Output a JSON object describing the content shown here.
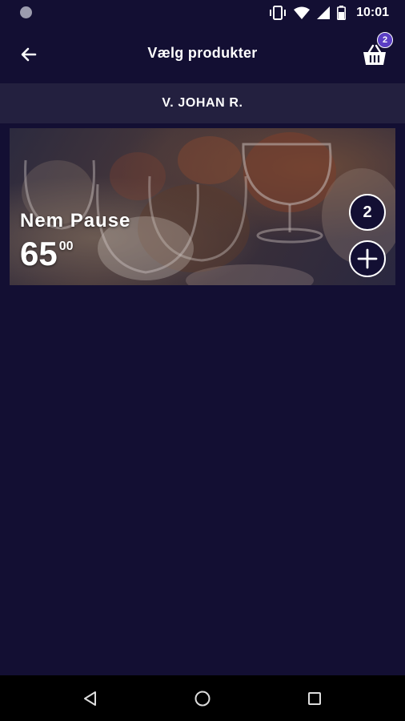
{
  "status_bar": {
    "time": "10:01"
  },
  "app_bar": {
    "title": "Vælg produkter",
    "basket_count": "2"
  },
  "section": {
    "title": "V. JOHAN R."
  },
  "product": {
    "name": "Nem Pause",
    "price_main": "65",
    "price_cents": "00",
    "quantity": "2"
  },
  "colors": {
    "background": "#130f33",
    "section_header": "#23203f",
    "badge": "#5b3fc4"
  }
}
